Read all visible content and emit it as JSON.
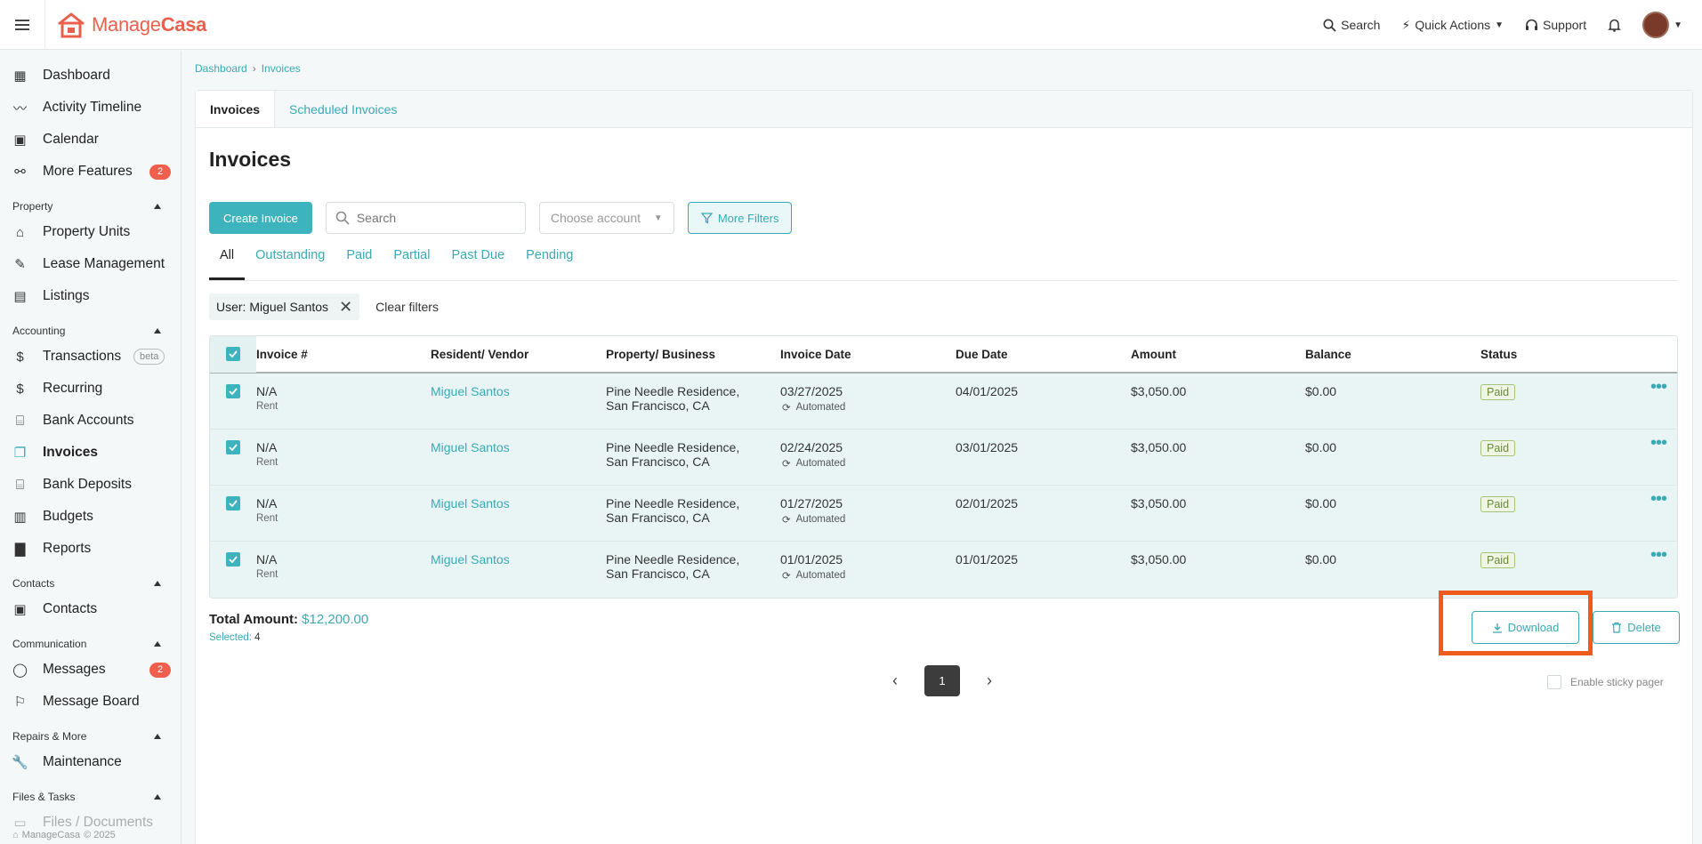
{
  "brand": {
    "name_a": "Manage",
    "name_b": "Casa",
    "footer": "ManageCasa",
    "footer_year": "© 2025"
  },
  "topbar": {
    "search": "Search",
    "quick_actions": "Quick Actions",
    "support": "Support"
  },
  "sidebar": {
    "items_top": [
      {
        "label": "Dashboard",
        "icon": "dashboard-icon"
      },
      {
        "label": "Activity Timeline",
        "icon": "pulse-icon"
      },
      {
        "label": "Calendar",
        "icon": "calendar-icon"
      },
      {
        "label": "More Features",
        "icon": "features-icon",
        "badge": "2"
      }
    ],
    "sections": [
      {
        "title": "Property",
        "items": [
          {
            "label": "Property Units",
            "icon": "home-icon"
          },
          {
            "label": "Lease Management",
            "icon": "edit-icon"
          },
          {
            "label": "Listings",
            "icon": "listing-icon"
          }
        ]
      },
      {
        "title": "Accounting",
        "items": [
          {
            "label": "Transactions",
            "icon": "dollar-icon",
            "beta": "beta"
          },
          {
            "label": "Recurring",
            "icon": "dollar-recurring-icon"
          },
          {
            "label": "Bank Accounts",
            "icon": "bank-icon"
          },
          {
            "label": "Invoices",
            "icon": "invoice-icon",
            "active": true
          },
          {
            "label": "Bank Deposits",
            "icon": "deposit-icon"
          },
          {
            "label": "Budgets",
            "icon": "budget-icon"
          },
          {
            "label": "Reports",
            "icon": "chart-icon"
          }
        ]
      },
      {
        "title": "Contacts",
        "items": [
          {
            "label": "Contacts",
            "icon": "contact-card-icon"
          }
        ]
      },
      {
        "title": "Communication",
        "items": [
          {
            "label": "Messages",
            "icon": "chat-icon",
            "badge": "2"
          },
          {
            "label": "Message Board",
            "icon": "board-icon"
          }
        ]
      },
      {
        "title": "Repairs & More",
        "items": [
          {
            "label": "Maintenance",
            "icon": "wrench-icon"
          }
        ]
      },
      {
        "title": "Files & Tasks",
        "items": [
          {
            "label": "Files / Documents",
            "icon": "folder-icon"
          }
        ]
      }
    ]
  },
  "breadcrumb": {
    "root": "Dashboard",
    "current": "Invoices"
  },
  "tabs": {
    "invoices": "Invoices",
    "scheduled": "Scheduled Invoices"
  },
  "page_title": "Invoices",
  "toolbar": {
    "create": "Create Invoice",
    "search_placeholder": "Search",
    "account_placeholder": "Choose account",
    "more_filters": "More Filters"
  },
  "filter_tabs": [
    "All",
    "Outstanding",
    "Paid",
    "Partial",
    "Past Due",
    "Pending"
  ],
  "chips": {
    "user": "User: Miguel Santos",
    "clear": "Clear filters"
  },
  "table": {
    "headers": [
      "Invoice #",
      "Resident/ Vendor",
      "Property/ Business",
      "Invoice Date",
      "Due Date",
      "Amount",
      "Balance",
      "Status"
    ],
    "rows": [
      {
        "invoice": "N/A",
        "type": "Rent",
        "resident": "Miguel Santos",
        "property_1": "Pine Needle Residence,",
        "property_2": "San Francisco, CA",
        "invoice_date": "03/27/2025",
        "auto": "Automated",
        "due": "04/01/2025",
        "amount": "$3,050.00",
        "balance": "$0.00",
        "status": "Paid"
      },
      {
        "invoice": "N/A",
        "type": "Rent",
        "resident": "Miguel Santos",
        "property_1": "Pine Needle Residence,",
        "property_2": "San Francisco, CA",
        "invoice_date": "02/24/2025",
        "auto": "Automated",
        "due": "03/01/2025",
        "amount": "$3,050.00",
        "balance": "$0.00",
        "status": "Paid"
      },
      {
        "invoice": "N/A",
        "type": "Rent",
        "resident": "Miguel Santos",
        "property_1": "Pine Needle Residence,",
        "property_2": "San Francisco, CA",
        "invoice_date": "01/27/2025",
        "auto": "Automated",
        "due": "02/01/2025",
        "amount": "$3,050.00",
        "balance": "$0.00",
        "status": "Paid"
      },
      {
        "invoice": "N/A",
        "type": "Rent",
        "resident": "Miguel Santos",
        "property_1": "Pine Needle Residence,",
        "property_2": "San Francisco, CA",
        "invoice_date": "01/01/2025",
        "auto": "Automated",
        "due": "01/01/2025",
        "amount": "$3,050.00",
        "balance": "$0.00",
        "status": "Paid"
      }
    ]
  },
  "footer": {
    "total_label": "Total Amount:",
    "total_value": "$12,200.00",
    "selected_label": "Selected:",
    "selected_count": "4",
    "download": "Download",
    "delete": "Delete",
    "page": "1",
    "sticky": "Enable sticky pager"
  },
  "colors": {
    "brand": "#e9614c",
    "accent": "#3aa9b4",
    "highlight": "#ef5b1a"
  }
}
